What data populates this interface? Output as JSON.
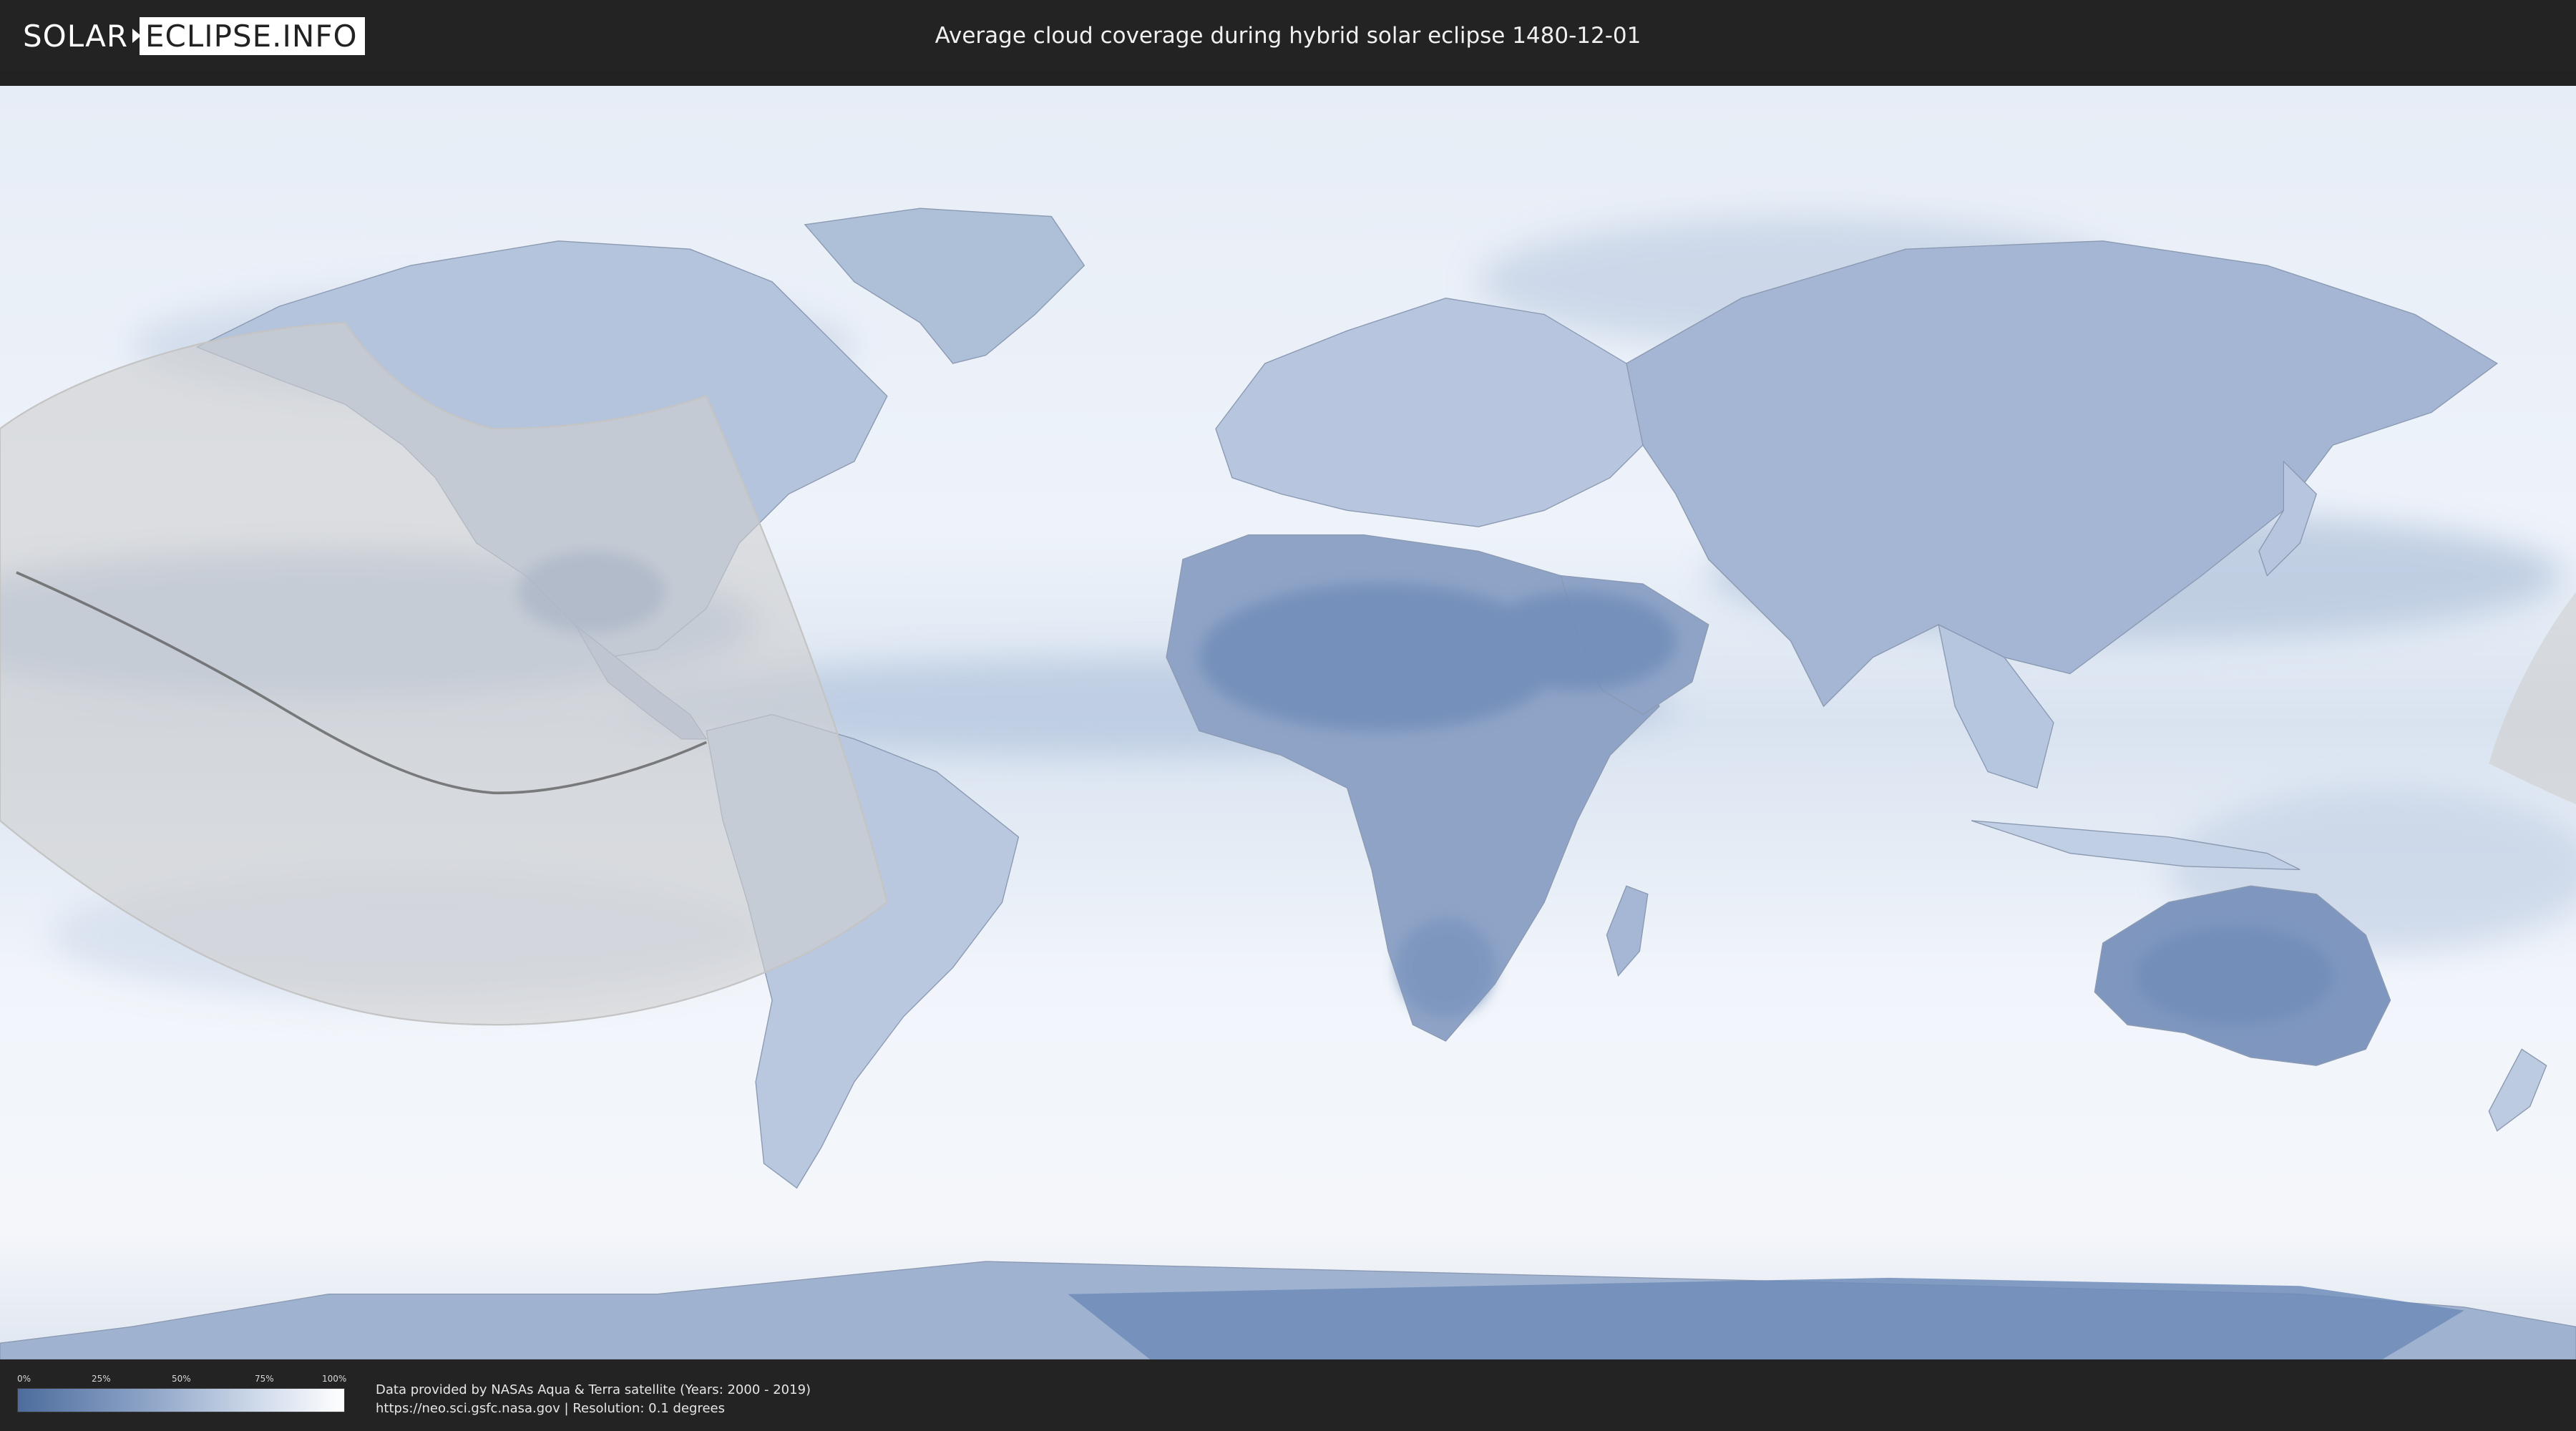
{
  "header": {
    "logo_part1": "SOLAR",
    "logo_part2": "ECLIPSE.INFO",
    "title": "Average cloud coverage during hybrid solar eclipse 1480-12-01"
  },
  "legend": {
    "ticks": [
      "0%",
      "25%",
      "50%",
      "75%",
      "100%"
    ],
    "gradient_colors": [
      "#4d6c9d",
      "#8ea5c8",
      "#d2dcec",
      "#ffffff"
    ]
  },
  "footer": {
    "credit_line1": "Data provided by NASAs Aqua & Terra satellite (Years: 2000 - 2019)",
    "credit_line2": "https://neo.sci.gsfc.nasa.gov | Resolution: 0.1 degrees"
  },
  "colors": {
    "background": "#222222",
    "ocean_cloud_light": "#eef2f9",
    "clear_sky_blue": "#6f8cb8",
    "eclipse_zone": "#d6d6d6",
    "path_line": "#555555"
  }
}
